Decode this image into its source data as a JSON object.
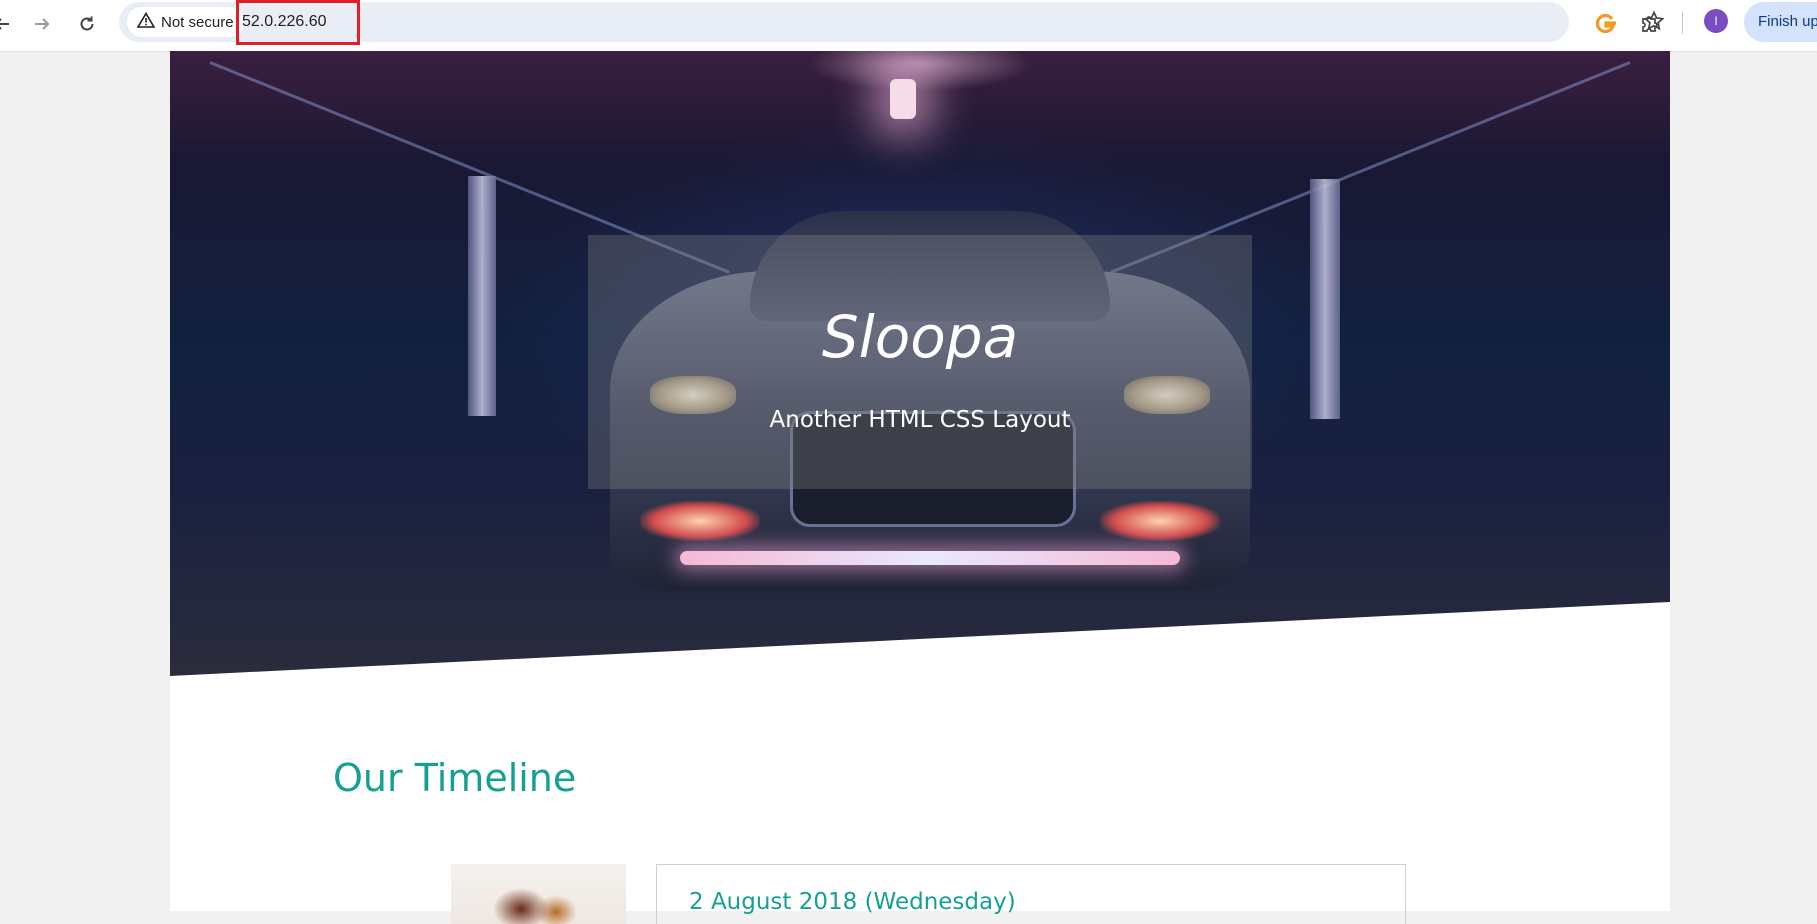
{
  "browser": {
    "security_label": "Not secure",
    "url": "52.0.226.60",
    "avatar_initial": "I",
    "finish_button_label": "Finish up",
    "icons": [
      "back-icon",
      "forward-icon",
      "reload-icon",
      "warning-icon",
      "star-icon",
      "extension-g-icon",
      "puzzle-icon"
    ],
    "colors": {
      "highlight_border": "#e01f26",
      "avatar": "#7a4cc2",
      "finish_bg": "#d3e3fd"
    }
  },
  "hero": {
    "title": "Sloopa",
    "subtitle": "Another HTML CSS Layout"
  },
  "timeline": {
    "heading": "Our Timeline",
    "items": [
      {
        "date": "2 August 2018 (Wednesday)"
      }
    ]
  },
  "theme": {
    "accent": "#16a095"
  }
}
